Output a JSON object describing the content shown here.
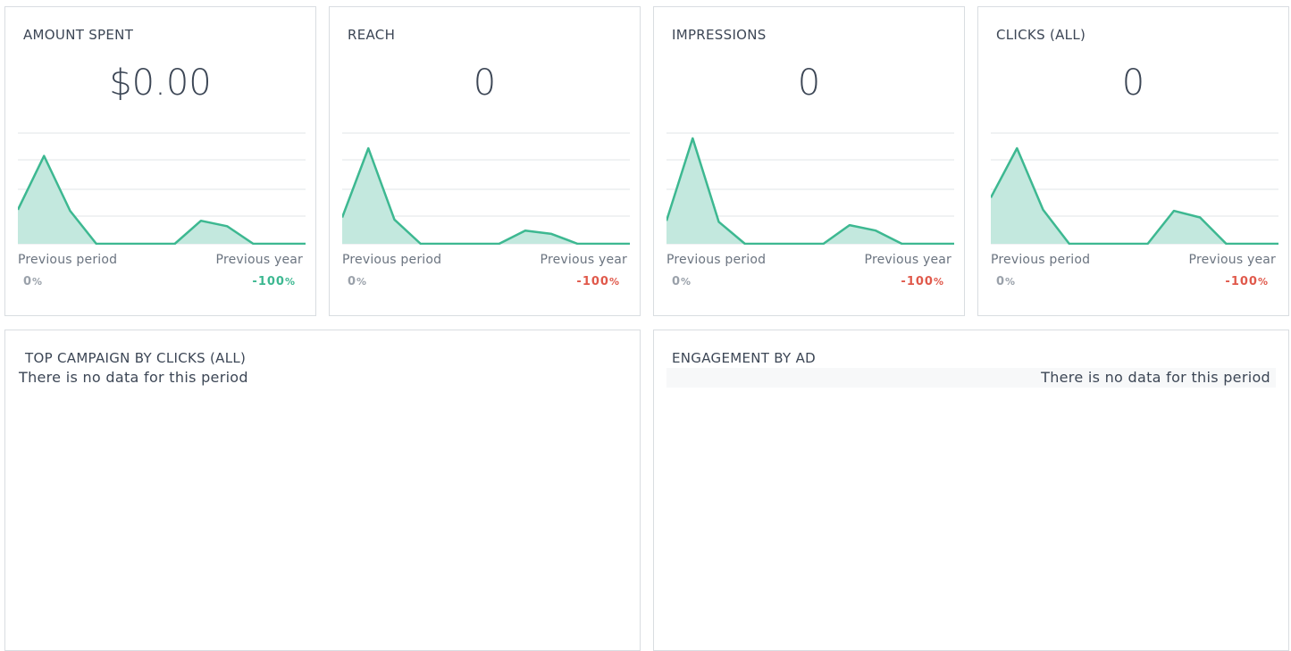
{
  "colors": {
    "line": "#3db891",
    "fill": "#c3e8de",
    "grid": "#e1e4e7",
    "positive": "#3db891",
    "negative": "#e0594b"
  },
  "metrics": [
    {
      "title": "AMOUNT SPENT",
      "value": "$0.00",
      "prev_period_label": "Previous period",
      "prev_period_value": "0",
      "prev_period_unit": "%",
      "prev_year_label": "Previous year",
      "prev_year_value": "-100",
      "prev_year_unit": "%",
      "prev_year_status": "positive",
      "trend": [
        0.31,
        0.8,
        0.3,
        0,
        0,
        0,
        0,
        0.21,
        0.16,
        0,
        0,
        0
      ]
    },
    {
      "title": "REACH",
      "value": "0",
      "prev_period_label": "Previous period",
      "prev_period_value": "0",
      "prev_period_unit": "%",
      "prev_year_label": "Previous year",
      "prev_year_value": "-100",
      "prev_year_unit": "%",
      "prev_year_status": "negative",
      "trend": [
        0.24,
        0.87,
        0.22,
        0,
        0,
        0,
        0,
        0.12,
        0.09,
        0,
        0,
        0
      ]
    },
    {
      "title": "IMPRESSIONS",
      "value": "0",
      "prev_period_label": "Previous period",
      "prev_period_value": "0",
      "prev_period_unit": "%",
      "prev_year_label": "Previous year",
      "prev_year_value": "-100",
      "prev_year_unit": "%",
      "prev_year_status": "negative",
      "trend": [
        0.21,
        0.96,
        0.2,
        0,
        0,
        0,
        0,
        0.17,
        0.12,
        0,
        0,
        0
      ]
    },
    {
      "title": "CLICKS (ALL)",
      "value": "0",
      "prev_period_label": "Previous period",
      "prev_period_value": "0",
      "prev_period_unit": "%",
      "prev_year_label": "Previous year",
      "prev_year_value": "-100",
      "prev_year_unit": "%",
      "prev_year_status": "negative",
      "trend": [
        0.42,
        0.87,
        0.31,
        0,
        0,
        0,
        0,
        0.3,
        0.24,
        0,
        0,
        0
      ]
    }
  ],
  "panels": [
    {
      "title": "TOP CAMPAIGN BY CLICKS (ALL)",
      "message": "There is no data for this period"
    },
    {
      "title": "ENGAGEMENT BY AD",
      "message": "There is no data for this period"
    }
  ]
}
